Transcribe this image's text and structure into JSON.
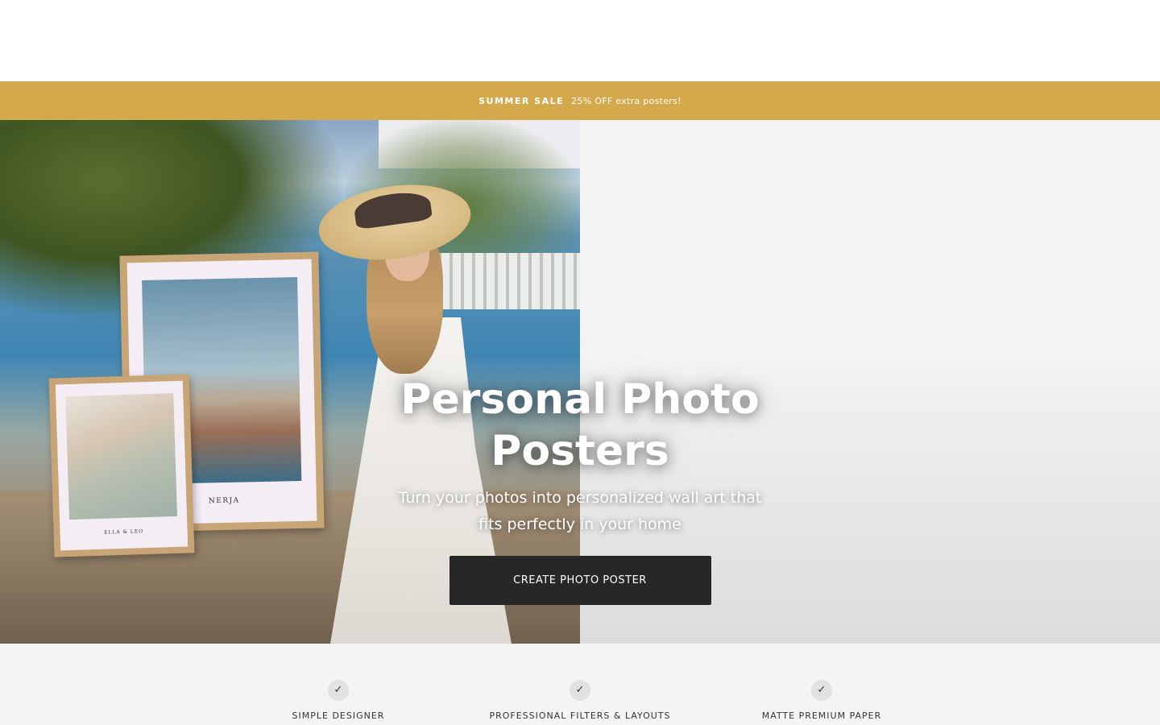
{
  "promo": {
    "highlight": "SUMMER SALE",
    "text": "25% OFF extra posters!"
  },
  "hero": {
    "title": "Personal Photo Posters",
    "subtitle": "Turn your photos into personalized wall art that fits perfectly in your home",
    "cta_label": "CREATE PHOTO POSTER",
    "poster_large_caption": "NERJA",
    "poster_small_caption": "ELLA & LEO"
  },
  "features": [
    {
      "icon": "check-icon",
      "label": "SIMPLE DESIGNER"
    },
    {
      "icon": "check-icon",
      "label": "PROFESSIONAL FILTERS & LAYOUTS"
    },
    {
      "icon": "check-icon",
      "label": "MATTE PREMIUM PAPER"
    }
  ],
  "colors": {
    "promo_bg": "#d4a94c",
    "cta_bg": "#272727",
    "features_bg": "#f4f4f4"
  }
}
